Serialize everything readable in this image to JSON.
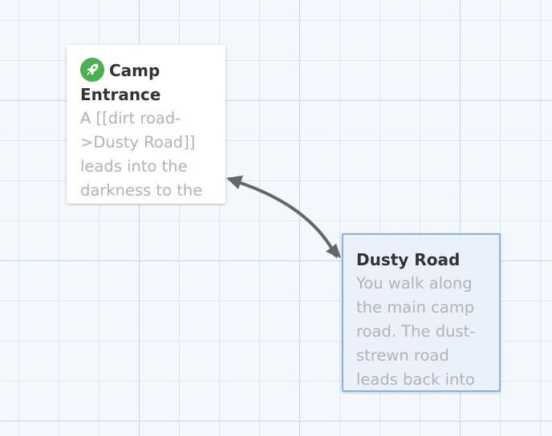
{
  "passages": [
    {
      "title": "Camp Entrance",
      "excerpt": "A [[dirt road->Dusty Road]] leads into the darkness to the",
      "is_start": true,
      "icon": "rocket-icon",
      "selected": false
    },
    {
      "title": "Dusty Road",
      "excerpt": "You walk along the main camp road. The dust-strewn road leads back into",
      "is_start": false,
      "selected": true
    }
  ],
  "colors": {
    "start_icon": "#4caf50",
    "arrow": "#666666",
    "selected_border": "#86b3e6",
    "grid": "#d8e7f6"
  }
}
